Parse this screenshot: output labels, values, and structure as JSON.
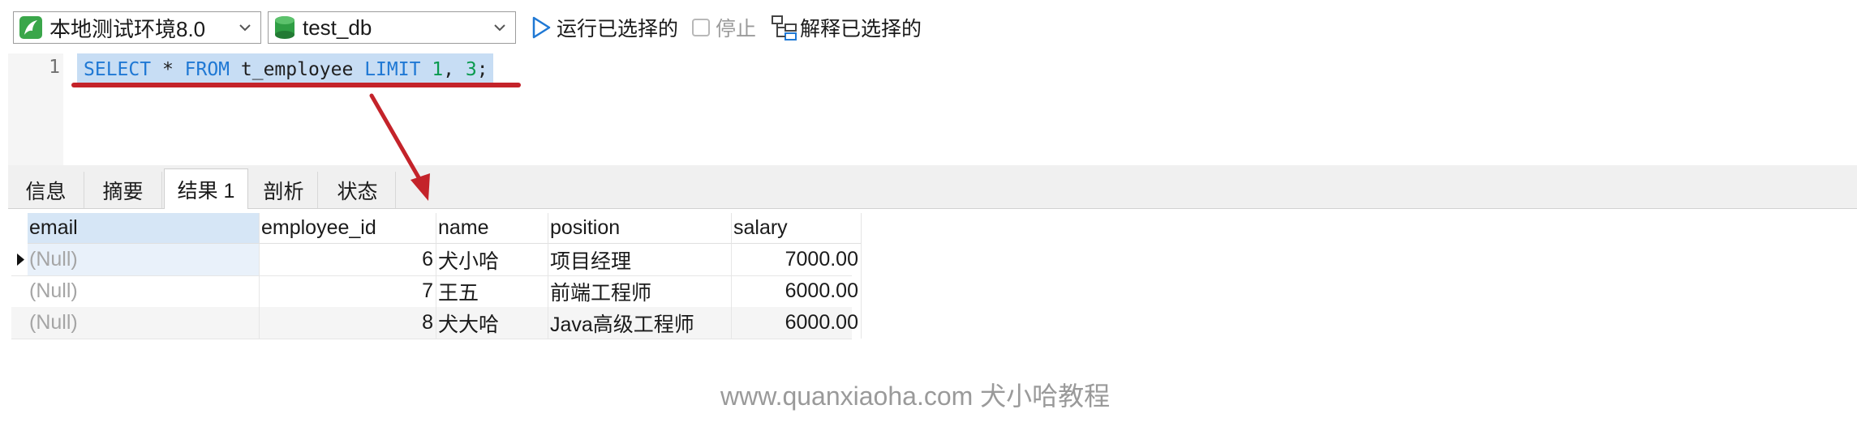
{
  "toolbar": {
    "connection": "本地测试环境8.0",
    "database": "test_db",
    "run_selected": "运行已选择的",
    "stop": "停止",
    "explain_selected": "解释已选择的"
  },
  "editor": {
    "line_number": "1",
    "sql": {
      "select": "SELECT",
      "star": " * ",
      "from": "FROM",
      "table": " t_employee ",
      "limit": "LIMIT",
      "space": " ",
      "n1": "1",
      "comma": ", ",
      "n2": "3",
      "semi": ";"
    }
  },
  "tabs": [
    "信息",
    "摘要",
    "结果 1",
    "剖析",
    "状态"
  ],
  "active_tab": "结果 1",
  "grid": {
    "columns": [
      "email",
      "employee_id",
      "name",
      "position",
      "salary"
    ],
    "rows": [
      {
        "email": "(Null)",
        "employee_id": "6",
        "name": "犬小哈",
        "position": "项目经理",
        "salary": "7000.00"
      },
      {
        "email": "(Null)",
        "employee_id": "7",
        "name": "王五",
        "position": "前端工程师",
        "salary": "6000.00"
      },
      {
        "email": "(Null)",
        "employee_id": "8",
        "name": "犬大哈",
        "position": "Java高级工程师",
        "salary": "6000.00"
      }
    ]
  },
  "watermark": "www.quanxiaoha.com 犬小哈教程",
  "colors": {
    "annotation": "#c4232a",
    "keyword": "#1f78d4",
    "number": "#0a9a4e",
    "selection": "#c7ddf4"
  }
}
